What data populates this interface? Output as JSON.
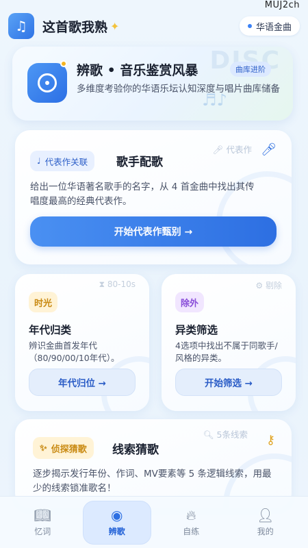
{
  "watermark": "MUJ2ch",
  "header": {
    "title": "这首歌我熟",
    "category_chip": "华语金曲",
    "icons": {
      "app": "music-note-icon",
      "sparkle": "sparkle-icon"
    }
  },
  "hero": {
    "title": "辨歌 • 音乐鉴赏风暴",
    "tag": "曲库进阶",
    "description": "多维度考验你的华语乐坛认知深度与唱片曲库储备",
    "bg_text": "DISC",
    "icons": {
      "main": "disc-icon",
      "notes": "music-notes-icon"
    }
  },
  "singer_card": {
    "tag": "代表作关联",
    "title": "歌手配歌",
    "hint": "代表作",
    "description": "给出一位华语著名歌手的名字，从 4 首金曲中找出其传唱度最高的经典代表作。",
    "button": "开始代表作甄别 →",
    "icons": {
      "tag": "music-note-icon",
      "hint": "microphone-icon",
      "corner": "microphone-icon"
    }
  },
  "era_card": {
    "tag": "时光",
    "hint": "80-10s",
    "title": "年代归类",
    "description": "辨识金曲首发年代（80/90/00/10年代）。",
    "button": "年代归位 →",
    "icons": {
      "hint": "hourglass-icon"
    }
  },
  "odd_card": {
    "tag": "除外",
    "hint": "剔除",
    "title": "异类筛选",
    "description": "4选项中找出不属于同歌手/风格的异类。",
    "button": "开始筛选 →",
    "icons": {
      "hint": "gear-icon"
    }
  },
  "clue_card": {
    "tag": "侦探猜歌",
    "title": "线索猜歌",
    "hint": "5条线索",
    "description": "逐步揭示发行年份、作词、MV要素等 5 条逻辑线索，用最少的线索锁准歌名！",
    "icons": {
      "tag": "sparkle-icon",
      "hint": "magnifier-icon",
      "corner": "key-icon"
    }
  },
  "nav": {
    "items": [
      {
        "label": "忆词",
        "icon": "book-icon",
        "active": false
      },
      {
        "label": "辨歌",
        "icon": "disc-icon",
        "active": true
      },
      {
        "label": "自练",
        "icon": "flame-icon",
        "active": false
      },
      {
        "label": "我的",
        "icon": "person-icon",
        "active": false
      }
    ]
  },
  "colors": {
    "accent": "#2d6fe2",
    "gold": "#c98a12",
    "purple": "#8a4fd9"
  }
}
